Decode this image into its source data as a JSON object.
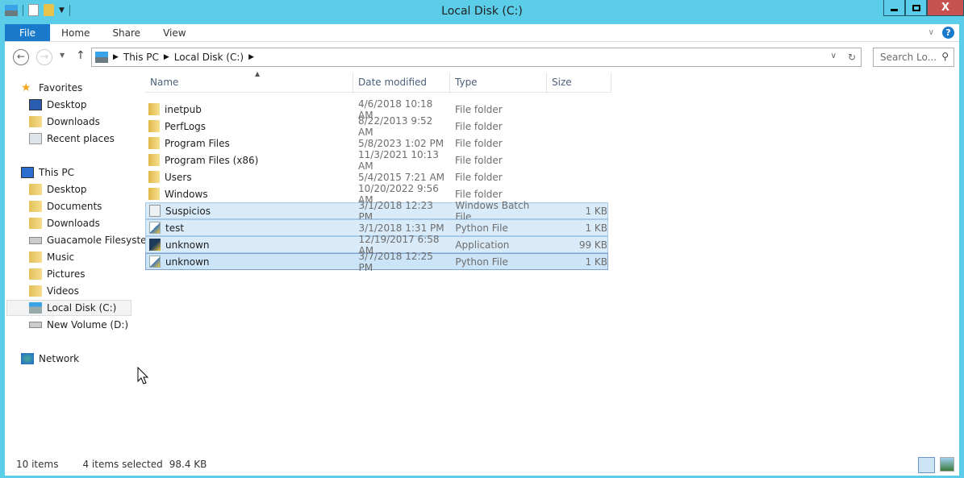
{
  "window": {
    "title": "Local Disk (C:)",
    "minimize_icon": "minimize-icon",
    "maximize_icon": "maximize-icon",
    "close_label": "X"
  },
  "ribbon": {
    "tabs": [
      {
        "label": "File"
      },
      {
        "label": "Home"
      },
      {
        "label": "Share"
      },
      {
        "label": "View"
      }
    ],
    "help": "?"
  },
  "address": {
    "crumbs": [
      "This PC",
      "Local Disk (C:)"
    ],
    "search_placeholder": "Search Lo..."
  },
  "nav": {
    "favorites": {
      "label": "Favorites",
      "items": [
        "Desktop",
        "Downloads",
        "Recent places"
      ]
    },
    "this_pc": {
      "label": "This PC",
      "items": [
        "Desktop",
        "Documents",
        "Downloads",
        "Guacamole Filesyste",
        "Music",
        "Pictures",
        "Videos",
        "Local Disk (C:)",
        "New Volume (D:)"
      ]
    },
    "network": {
      "label": "Network"
    }
  },
  "columns": [
    "Name",
    "Date modified",
    "Type",
    "Size"
  ],
  "files": [
    {
      "name": "inetpub",
      "date": "4/6/2018 10:18 AM",
      "type": "File folder",
      "size": "",
      "icon": "folder-icon"
    },
    {
      "name": "PerfLogs",
      "date": "8/22/2013 9:52 AM",
      "type": "File folder",
      "size": "",
      "icon": "folder-icon"
    },
    {
      "name": "Program Files",
      "date": "5/8/2023 1:02 PM",
      "type": "File folder",
      "size": "",
      "icon": "folder-icon"
    },
    {
      "name": "Program Files (x86)",
      "date": "11/3/2021 10:13 AM",
      "type": "File folder",
      "size": "",
      "icon": "folder-icon"
    },
    {
      "name": "Users",
      "date": "5/4/2015 7:21 AM",
      "type": "File folder",
      "size": "",
      "icon": "folder-icon"
    },
    {
      "name": "Windows",
      "date": "10/20/2022 9:56 AM",
      "type": "File folder",
      "size": "",
      "icon": "folder-icon"
    },
    {
      "name": "Suspicios",
      "date": "3/1/2018 12:23 PM",
      "type": "Windows Batch File",
      "size": "1 KB",
      "icon": "batch-file-icon"
    },
    {
      "name": "test",
      "date": "3/1/2018 1:31 PM",
      "type": "Python File",
      "size": "1 KB",
      "icon": "python-file-icon"
    },
    {
      "name": "unknown",
      "date": "12/19/2017 6:58 AM",
      "type": "Application",
      "size": "99 KB",
      "icon": "application-icon"
    },
    {
      "name": "unknown",
      "date": "3/7/2018 12:25 PM",
      "type": "Python File",
      "size": "1 KB",
      "icon": "python-file-icon"
    }
  ],
  "status": {
    "count": "10 items",
    "selected": "4 items selected",
    "size": "98.4 KB"
  }
}
